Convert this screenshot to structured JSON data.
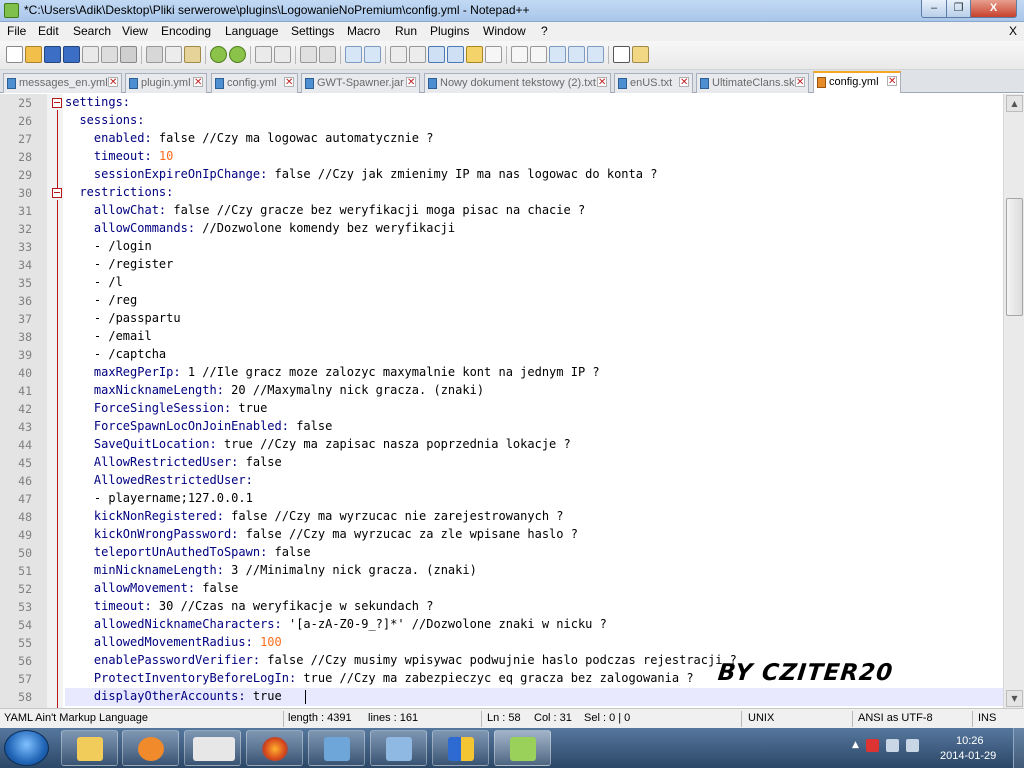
{
  "window": {
    "title": "*C:\\Users\\Adik\\Desktop\\Pliki serwerowe\\plugins\\LogowanieNoPremium\\config.yml - Notepad++",
    "min": "‒",
    "max": "❐",
    "close": "X"
  },
  "menu": [
    "File",
    "Edit",
    "Search",
    "View",
    "Encoding",
    "Language",
    "Settings",
    "Macro",
    "Run",
    "Plugins",
    "Window",
    "?"
  ],
  "menu_close": "X",
  "tabs": [
    {
      "label": "messages_en.yml"
    },
    {
      "label": "plugin.yml"
    },
    {
      "label": "config.yml"
    },
    {
      "label": "GWT-Spawner.jar"
    },
    {
      "label": "Nowy dokument tekstowy (2).txt"
    },
    {
      "label": "enUS.txt"
    },
    {
      "label": "UltimateClans.sk"
    },
    {
      "label": "config.yml"
    }
  ],
  "lines": [
    {
      "n": "25",
      "key": "settings:",
      "rest": ""
    },
    {
      "n": "26",
      "key": "  sessions:",
      "rest": ""
    },
    {
      "n": "27",
      "key": "    enabled:",
      "rest": " false //Czy ma logowac automatycznie ?"
    },
    {
      "n": "28",
      "key": "    timeout:",
      "rest": " ",
      "num": "10"
    },
    {
      "n": "29",
      "key": "    sessionExpireOnIpChange:",
      "rest": " false //Czy jak zmienimy IP ma nas logowac do konta ?"
    },
    {
      "n": "30",
      "key": "  restrictions:",
      "rest": ""
    },
    {
      "n": "31",
      "key": "    allowChat:",
      "rest": " false //Czy gracze bez weryfikacji moga pisac na chacie ?"
    },
    {
      "n": "32",
      "key": "    allowCommands:",
      "rest": " //Dozwolone komendy bez weryfikacji"
    },
    {
      "n": "33",
      "key": "",
      "rest": "    - /login"
    },
    {
      "n": "34",
      "key": "",
      "rest": "    - /register"
    },
    {
      "n": "35",
      "key": "",
      "rest": "    - /l"
    },
    {
      "n": "36",
      "key": "",
      "rest": "    - /reg"
    },
    {
      "n": "37",
      "key": "",
      "rest": "    - /passpartu"
    },
    {
      "n": "38",
      "key": "",
      "rest": "    - /email"
    },
    {
      "n": "39",
      "key": "",
      "rest": "    - /captcha"
    },
    {
      "n": "40",
      "key": "    maxRegPerIp:",
      "rest": " 1 //Ile gracz moze zalozyc maxymalnie kont na jednym IP ?"
    },
    {
      "n": "41",
      "key": "    maxNicknameLength:",
      "rest": " 20 //Maxymalny nick gracza. (znaki)"
    },
    {
      "n": "42",
      "key": "    ForceSingleSession:",
      "rest": " true"
    },
    {
      "n": "43",
      "key": "    ForceSpawnLocOnJoinEnabled:",
      "rest": " false"
    },
    {
      "n": "44",
      "key": "    SaveQuitLocation:",
      "rest": " true //Czy ma zapisac nasza poprzednia lokacje ?"
    },
    {
      "n": "45",
      "key": "    AllowRestrictedUser:",
      "rest": " false"
    },
    {
      "n": "46",
      "key": "    AllowedRestrictedUser:",
      "rest": ""
    },
    {
      "n": "47",
      "key": "",
      "rest": "    - playername;127.0.0.1"
    },
    {
      "n": "48",
      "key": "    kickNonRegistered:",
      "rest": " false //Czy ma wyrzucac nie zarejestrowanych ?"
    },
    {
      "n": "49",
      "key": "    kickOnWrongPassword:",
      "rest": " false //Czy ma wyrzucac za zle wpisane haslo ?"
    },
    {
      "n": "50",
      "key": "    teleportUnAuthedToSpawn:",
      "rest": " false"
    },
    {
      "n": "51",
      "key": "    minNicknameLength:",
      "rest": " 3 //Minimalny nick gracza. (znaki)"
    },
    {
      "n": "52",
      "key": "    allowMovement:",
      "rest": " false"
    },
    {
      "n": "53",
      "key": "    timeout:",
      "rest": " 30 //Czas na weryfikacje w sekundach ?"
    },
    {
      "n": "54",
      "key": "    allowedNicknameCharacters:",
      "rest": " '[a-zA-Z0-9_?]*' //Dozwolone znaki w nicku ?"
    },
    {
      "n": "55",
      "key": "    allowedMovementRadius:",
      "rest": " ",
      "num": "100"
    },
    {
      "n": "56",
      "key": "    enablePasswordVerifier:",
      "rest": " false //Czy musimy wpisywac podwujnie haslo podczas rejestracji ?"
    },
    {
      "n": "57",
      "key": "    ProtectInventoryBeforeLogIn:",
      "rest": " true //Czy ma zabezpieczyc eq gracza bez zalogowania ?"
    },
    {
      "n": "58",
      "key": "    displayOtherAccounts:",
      "rest": " true"
    }
  ],
  "watermark": "BY CZITER20",
  "status": {
    "language": "YAML Ain't Markup Language",
    "length": "length : 4391",
    "lines": "lines : 161",
    "ln": "Ln : 58",
    "col": "Col : 31",
    "sel": "Sel : 0 | 0",
    "eol": "UNIX",
    "encoding": "ANSI as UTF-8",
    "mode": "INS"
  },
  "clock": {
    "time": "10:26",
    "date": "2014-01-29"
  },
  "taskbar_apps": [
    "explorer-icon",
    "media-player-icon",
    "mpc-icon",
    "firefox-icon",
    "app-icon-5",
    "app-icon-6",
    "security-shield-icon",
    "notepadpp-icon"
  ],
  "colors": {
    "key": "#000080",
    "number": "#ff6c1a",
    "fold": "#b81818",
    "active_tab_accent": "#f5a623"
  }
}
